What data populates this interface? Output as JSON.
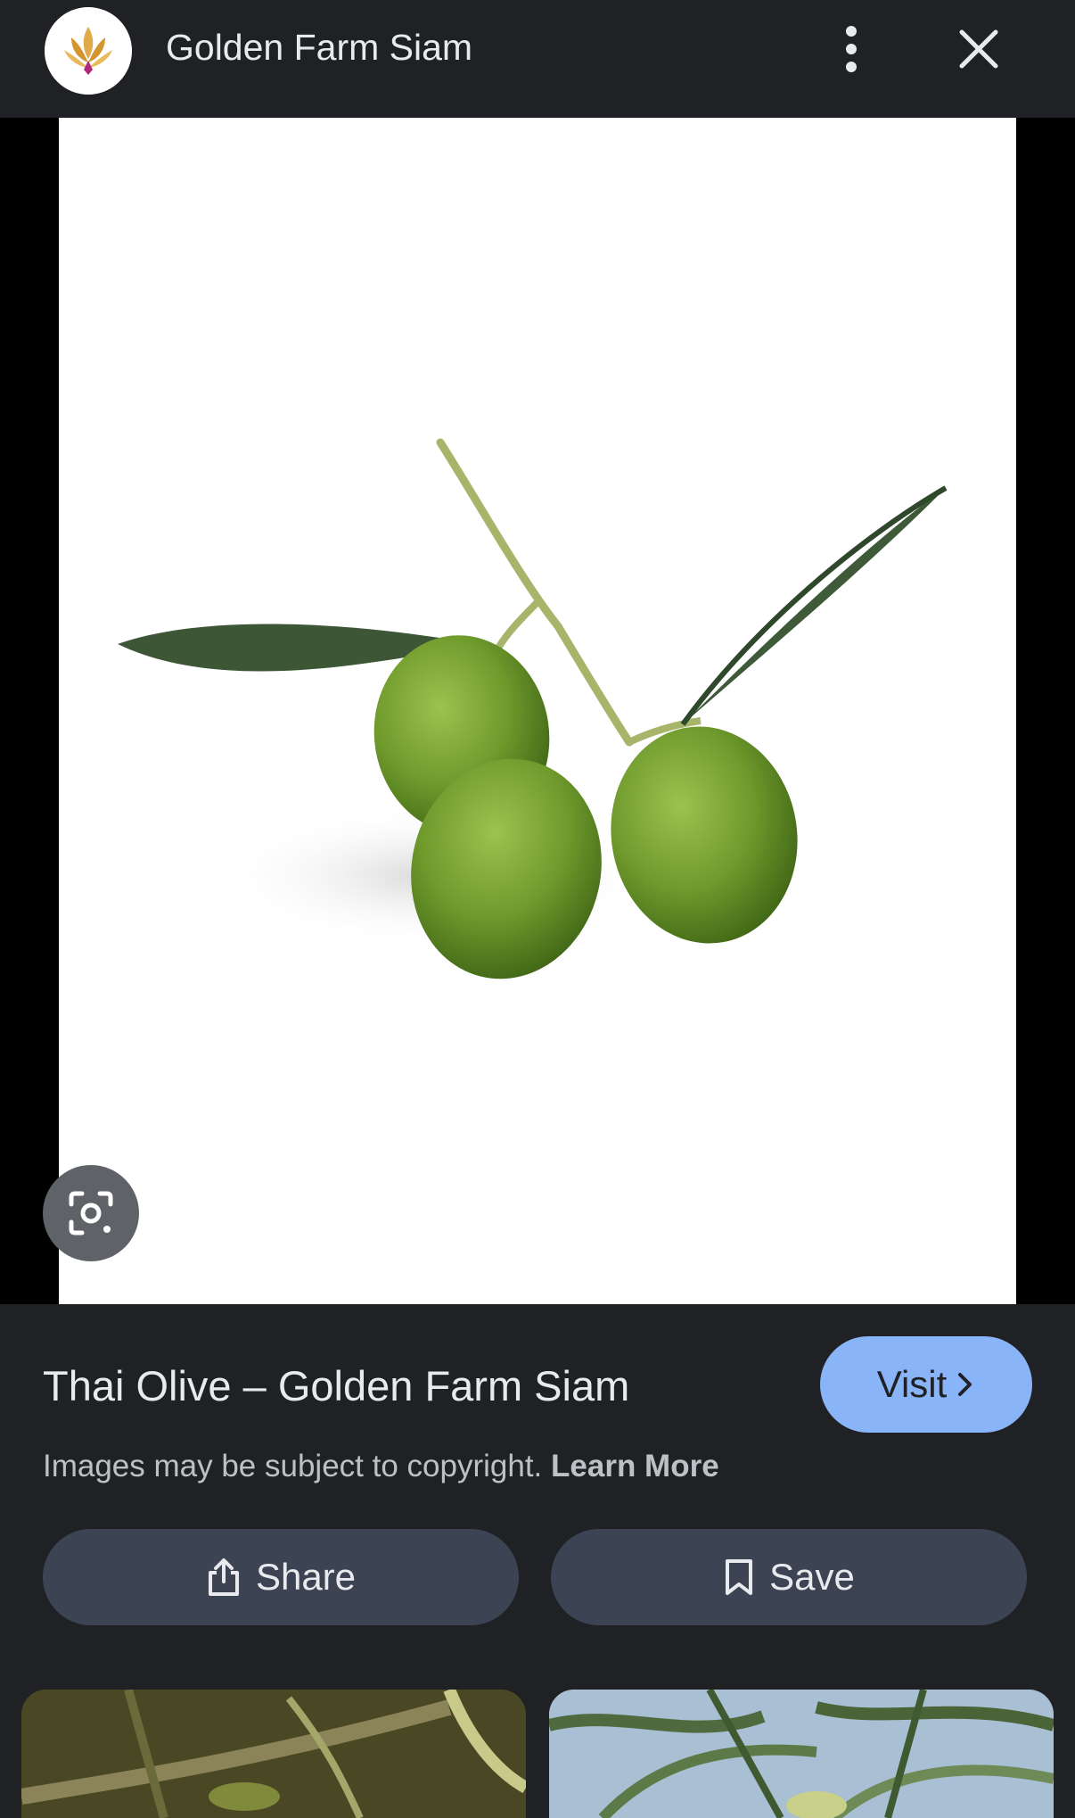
{
  "header": {
    "site_name": "Golden Farm Siam",
    "avatar_icon": "lotus-logo",
    "more_icon": "more-vertical-icon",
    "close_icon": "close-icon"
  },
  "viewer": {
    "image_subject": "green-olives-image",
    "lens_icon": "lens-search-icon"
  },
  "result": {
    "title": "Thai Olive – Golden Farm Siam",
    "visit_label": "Visit",
    "copyright_text": "Images may be subject to copyright.",
    "learn_more_label": "Learn More",
    "share_label": "Share",
    "save_label": "Save"
  },
  "colors": {
    "background": "#202124",
    "visit_button": "#8ab4f8",
    "action_button": "#3c4454",
    "text_primary": "#e8eaed",
    "text_secondary": "#bdc1c6"
  }
}
